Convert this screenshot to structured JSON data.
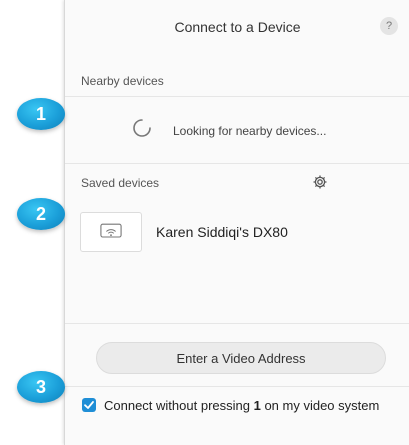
{
  "dialog": {
    "title": "Connect to a Device",
    "help_label": "?"
  },
  "nearby": {
    "header": "Nearby devices",
    "status": "Looking for nearby devices..."
  },
  "saved": {
    "header": "Saved devices",
    "devices": [
      {
        "name": "Karen Siddiqi's DX80",
        "icon": "wifi-screen-icon"
      }
    ]
  },
  "actions": {
    "enter_address_label": "Enter a Video Address"
  },
  "option": {
    "checked": true,
    "label_prefix": "Connect without pressing ",
    "label_bold": "1",
    "label_suffix": " on my video system"
  },
  "badges": [
    "1",
    "2",
    "3"
  ],
  "colors": {
    "accent": "#1f8ed6",
    "badge": "#1b9fd9"
  }
}
